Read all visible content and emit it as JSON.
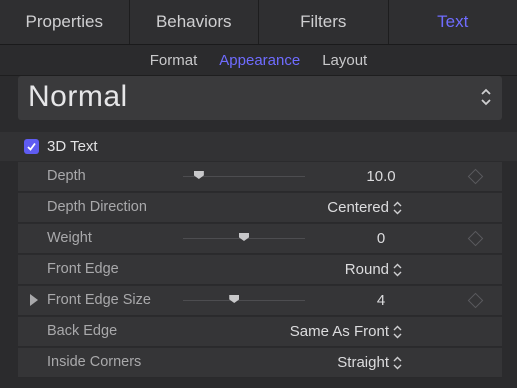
{
  "tabs": [
    {
      "label": "Properties"
    },
    {
      "label": "Behaviors"
    },
    {
      "label": "Filters"
    },
    {
      "label": "Text"
    }
  ],
  "subtabs": [
    {
      "label": "Format"
    },
    {
      "label": "Appearance"
    },
    {
      "label": "Layout"
    }
  ],
  "preset": {
    "value": "Normal"
  },
  "section": {
    "label": "3D Text",
    "checked": true
  },
  "rows": {
    "depth": {
      "label": "Depth",
      "value": "10.0",
      "slider_fraction": 0.13
    },
    "depth_direction": {
      "label": "Depth Direction",
      "value": "Centered"
    },
    "weight": {
      "label": "Weight",
      "value": "0",
      "slider_fraction": 0.5
    },
    "front_edge": {
      "label": "Front Edge",
      "value": "Round"
    },
    "front_edge_size": {
      "label": "Front Edge Size",
      "value": "4",
      "slider_fraction": 0.42
    },
    "back_edge": {
      "label": "Back Edge",
      "value": "Same As Front"
    },
    "inside_corners": {
      "label": "Inside Corners",
      "value": "Straight"
    }
  },
  "colors": {
    "accent": "#6f6cff",
    "background": "#2b2b2d",
    "row": "#353537"
  },
  "icons": [
    "checkbox-checked-icon",
    "chevron-updown-icon",
    "disclosure-triangle-icon",
    "keyframe-diamond-icon",
    "slider-thumb-icon"
  ]
}
